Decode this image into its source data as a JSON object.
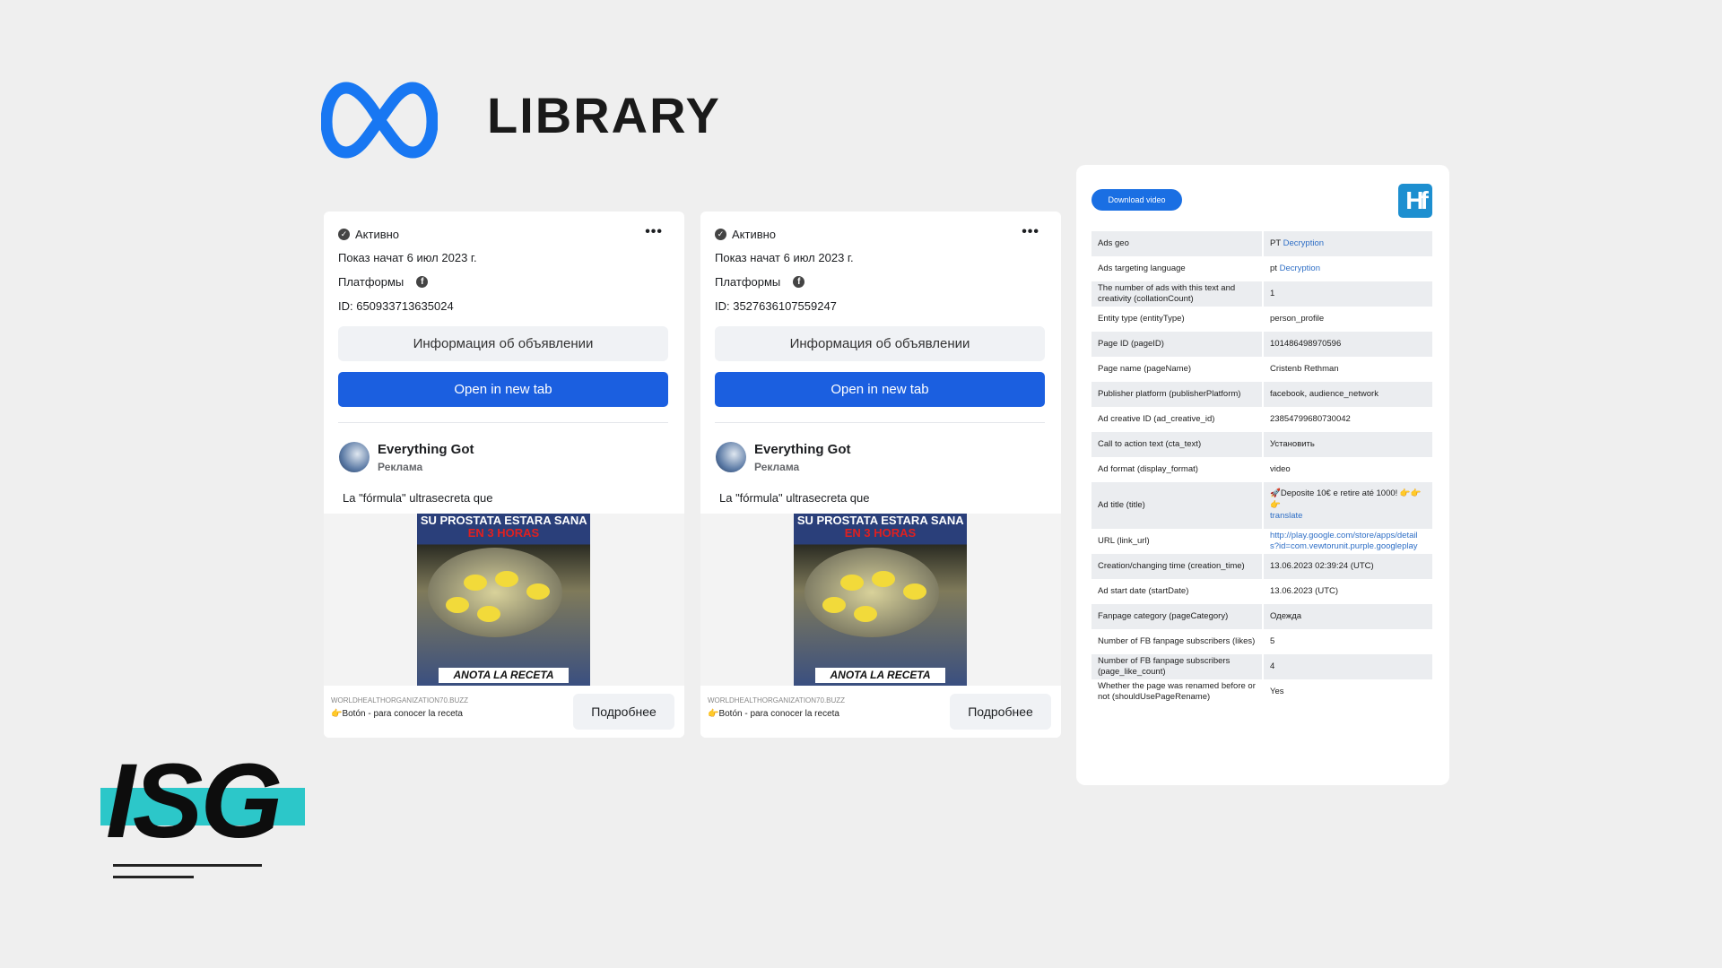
{
  "header": {
    "title": "LIBRARY",
    "logo": "meta-infinity-logo",
    "logo_color": "#1877f2"
  },
  "cards": [
    {
      "status": "Активно",
      "started": "Показ начат 6 июл 2023 г.",
      "platforms_label": "Платформы",
      "id": "ID: 650933713635024",
      "info_button": "Информация об объявлении",
      "open_button": "Open in new tab",
      "page_name": "Everything Got",
      "sponsored": "Реклама",
      "ad_text": "La \"fórmula\" ultrasecreta que",
      "creative_top": "SU PROSTATA ESTARA SANA",
      "creative_top_red": "EN 3 HORAS",
      "creative_bottom": "ANOTA LA RECETA",
      "domain": "WORLDHEALTHORGANIZATION70.BUZZ",
      "cta_text": "👉Botón - para conocer la receta",
      "more_button": "Подробнее"
    },
    {
      "status": "Активно",
      "started": "Показ начат 6 июл 2023 г.",
      "platforms_label": "Платформы",
      "id": "ID: 3527636107559247",
      "info_button": "Информация об объявлении",
      "open_button": "Open in new tab",
      "page_name": "Everything Got",
      "sponsored": "Реклама",
      "ad_text": "La \"fórmula\" ultrasecreta que",
      "creative_top": "SU PROSTATA ESTARA SANA",
      "creative_top_red": "EN 3 HORAS",
      "creative_bottom": "ANOTA LA RECETA",
      "domain": "WORLDHEALTHORGANIZATION70.BUZZ",
      "cta_text": "👉Botón - para conocer la receta",
      "more_button": "Подробнее"
    }
  ],
  "panel": {
    "download_button": "Download video",
    "logo": "Hf",
    "rows": [
      {
        "label": "Ads geo",
        "value": "PT",
        "link": "Decryption"
      },
      {
        "label": "Ads targeting language",
        "value": "pt",
        "link": "Decryption"
      },
      {
        "label": "The number of ads with this text and creativity (collationCount)",
        "value": "1"
      },
      {
        "label": "Entity type (entityType)",
        "value": "person_profile"
      },
      {
        "label": "Page ID (pageID)",
        "value": "101486498970596"
      },
      {
        "label": "Page name (pageName)",
        "value": "Cristenb Rethman"
      },
      {
        "label": "Publisher platform (publisherPlatform)",
        "value": "facebook, audience_network"
      },
      {
        "label": "Ad creative ID (ad_creative_id)",
        "value": "23854799680730042"
      },
      {
        "label": "Call to action text (cta_text)",
        "value": "Установить"
      },
      {
        "label": "Ad format (display_format)",
        "value": "video"
      },
      {
        "label": "Ad title (title)",
        "value": "🚀Deposite 10€ e retire até 1000! 👉👉👉",
        "link": "translate"
      },
      {
        "label": "URL (link_url)",
        "value": "",
        "link": "http://play.google.com/store/apps/details?id=com.vewtorunit.purple.googleplay"
      },
      {
        "label": "Creation/changing time (creation_time)",
        "value": "13.06.2023 02:39:24 (UTC)"
      },
      {
        "label": "Ad start date (startDate)",
        "value": "13.06.2023 (UTC)"
      },
      {
        "label": "Fanpage category (pageCategory)",
        "value": "Одежда"
      },
      {
        "label": "Number of FB fanpage subscribers (likes)",
        "value": "5"
      },
      {
        "label": "Number of FB fanpage subscribers (page_like_count)",
        "value": "4"
      },
      {
        "label": "Whether the page was renamed before or not (shouldUsePageRename)",
        "value": "Yes"
      }
    ]
  },
  "brand": {
    "text": "ISG",
    "accent": "#2cc7c9"
  }
}
